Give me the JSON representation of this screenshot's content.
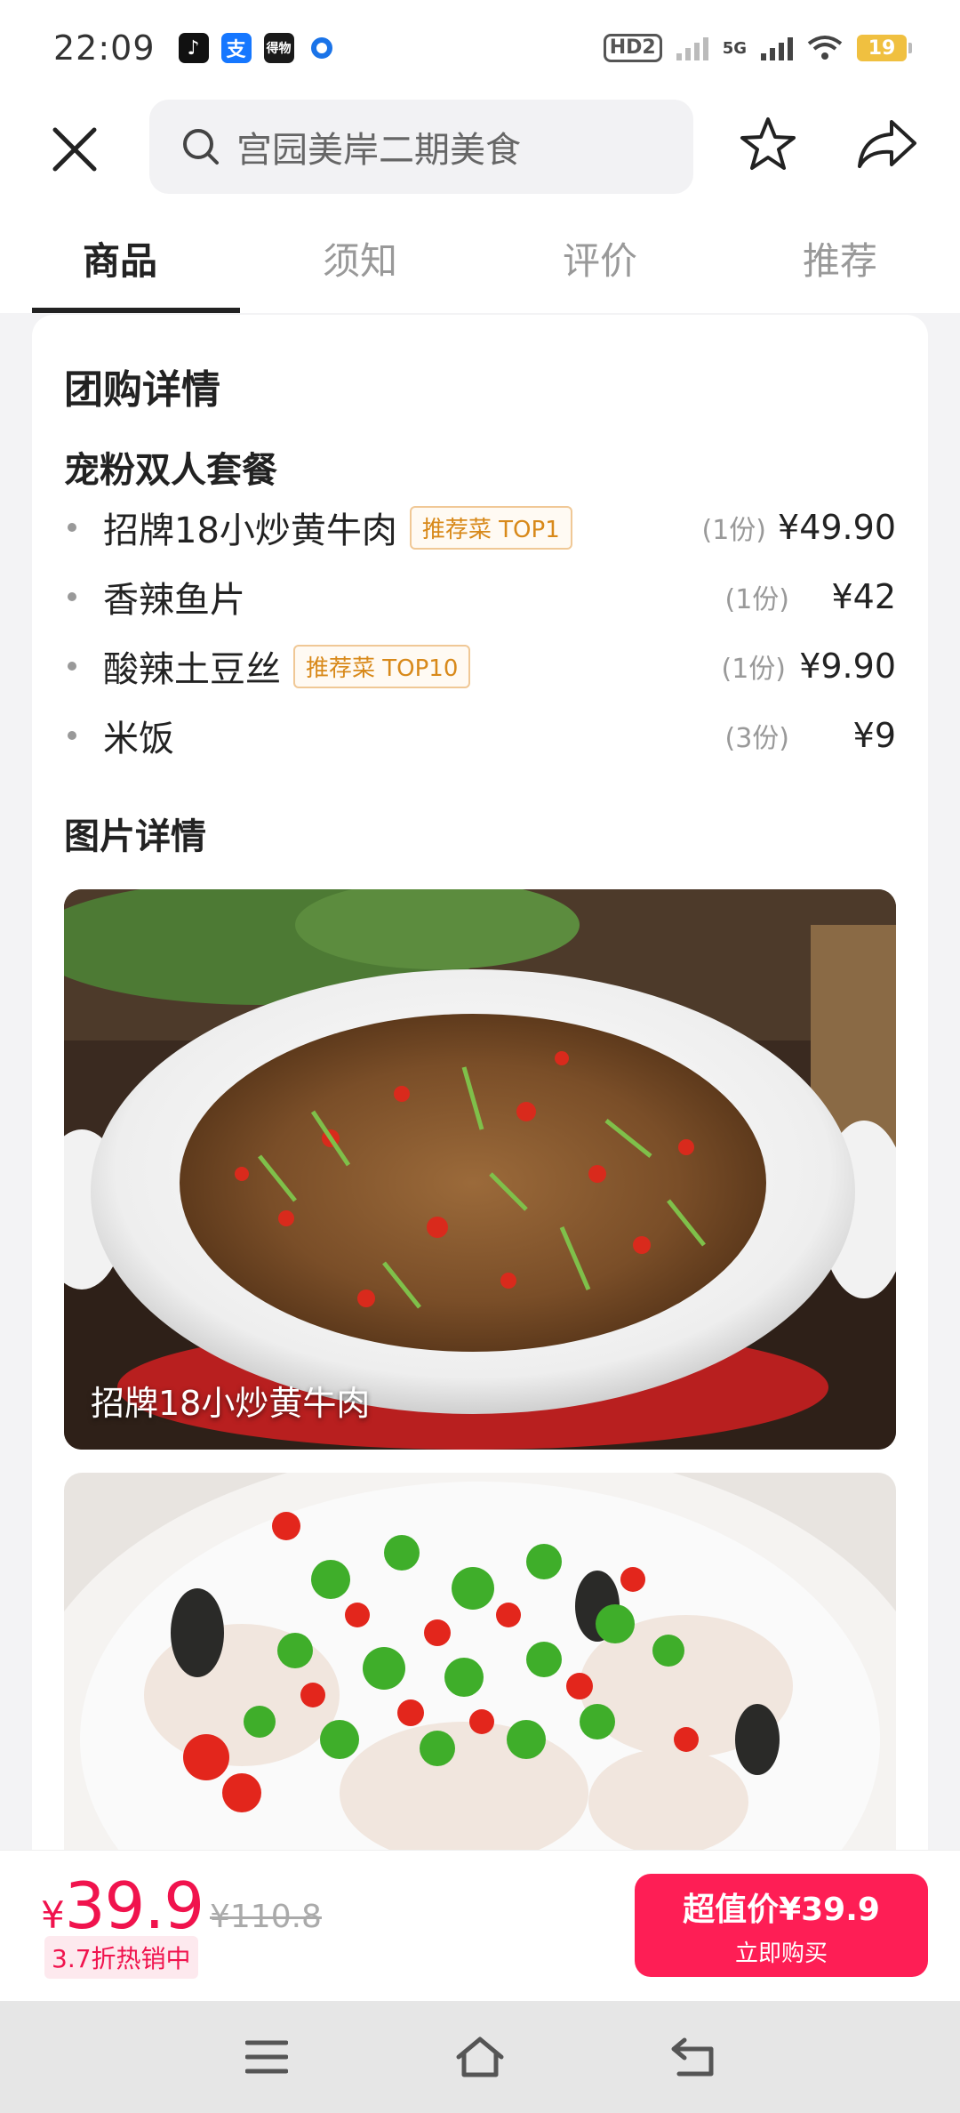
{
  "status_bar": {
    "time": "22:09",
    "notif_icons": [
      "tiktok-icon",
      "alipay-icon",
      "news-icon",
      "dot-icon"
    ],
    "alipay_glyph": "支",
    "news_glyph": "得物",
    "hd_label": "HD2",
    "network_label": "5G",
    "battery": "19"
  },
  "header": {
    "search_text": "宫园美岸二期美食"
  },
  "tabs": [
    {
      "label": "商品",
      "active": true
    },
    {
      "label": "须知",
      "active": false
    },
    {
      "label": "评价",
      "active": false
    },
    {
      "label": "推荐",
      "active": false
    }
  ],
  "deal": {
    "section_title": "团购详情",
    "set_name": "宠粉双人套餐",
    "items": [
      {
        "name": "招牌18小炒黄牛肉",
        "tag": "推荐菜 TOP1",
        "qty": "(1份)",
        "price": "¥49.90"
      },
      {
        "name": "香辣鱼片",
        "tag": "",
        "qty": "(1份)",
        "price": "¥42"
      },
      {
        "name": "酸辣土豆丝",
        "tag": "推荐菜 TOP10",
        "qty": "(1份)",
        "price": "¥9.90"
      },
      {
        "name": "米饭",
        "tag": "",
        "qty": "(3份)",
        "price": "¥9"
      }
    ]
  },
  "photos": {
    "section_title": "图片详情",
    "items": [
      {
        "caption": "招牌18小炒黄牛肉"
      },
      {
        "caption": ""
      }
    ]
  },
  "bottom": {
    "currency": "¥",
    "current_price": "39.9",
    "original_price": "¥110.8",
    "discount_label": "3.7折热销中",
    "buy_main": "超值价¥39.9",
    "buy_sub": "立即购买"
  },
  "colors": {
    "accent": "#fe1e55",
    "price": "#f0134d",
    "tag_text": "#d8891a"
  }
}
